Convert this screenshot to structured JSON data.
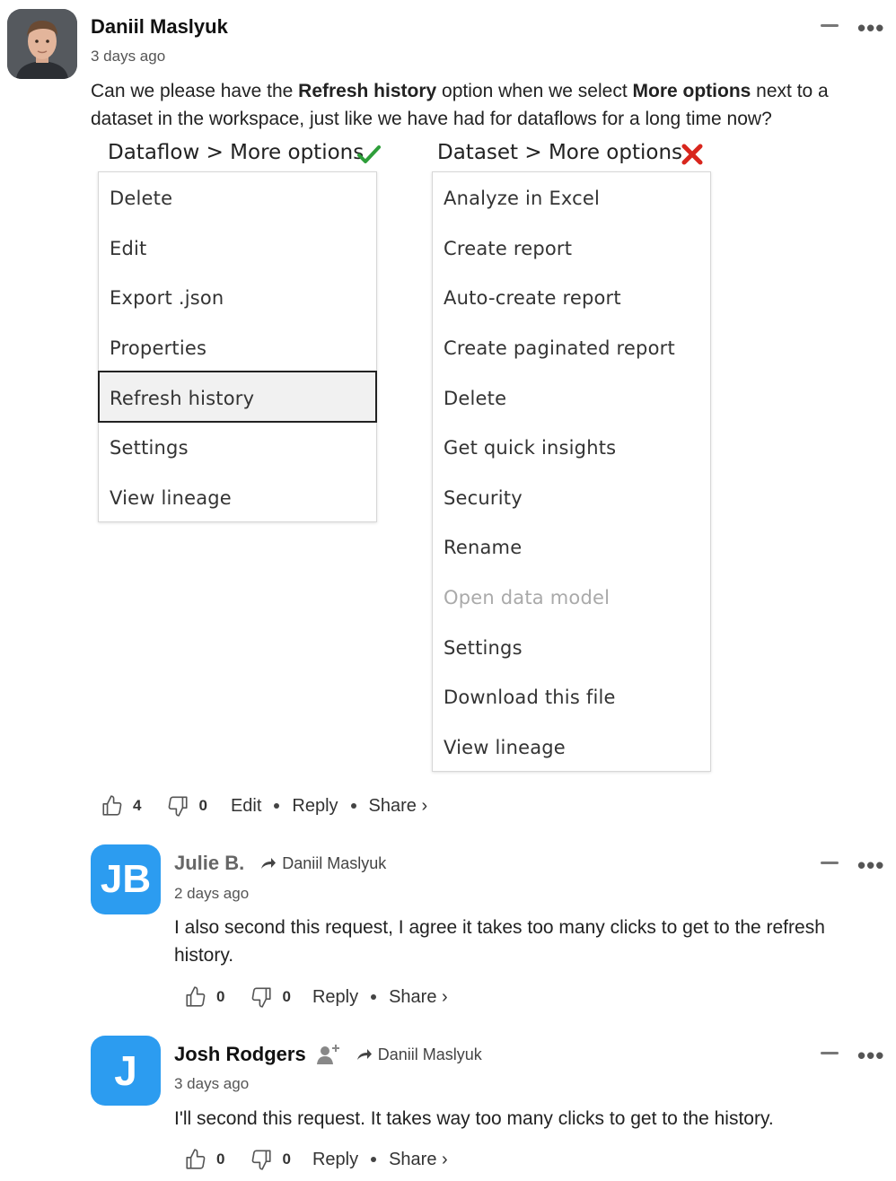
{
  "post": {
    "author": "Daniil Maslyuk",
    "time": "3 days ago",
    "body_pre": "Can we please have the ",
    "body_b1": "Refresh history",
    "body_mid": " option when we select ",
    "body_b2": "More options",
    "body_post": " next to a dataset in the workspace, just like we have had for dataflows for a long time now?",
    "likes": "4",
    "dislikes": "0",
    "edit_label": "Edit",
    "reply_label": "Reply",
    "share_label": "Share ›"
  },
  "screenshot": {
    "left_title": "Dataflow > More options",
    "right_title": "Dataset > More options",
    "left_items": [
      "Delete",
      "Edit",
      "Export .json",
      "Properties",
      "Refresh history",
      "Settings",
      "View lineage"
    ],
    "right_items": [
      "Analyze in Excel",
      "Create report",
      "Auto-create report",
      "Create paginated report",
      "Delete",
      "Get quick insights",
      "Security",
      "Rename",
      "Open data model",
      "Settings",
      "Download this file",
      "View lineage"
    ],
    "check_color": "#2e9e3a",
    "cross_color": "#d8261d"
  },
  "replies": [
    {
      "initials": "JB",
      "author": "Julie B.",
      "reply_to": "Daniil Maslyuk",
      "time": "2 days ago",
      "body": "I also second this request, I agree it takes too many clicks to get to the refresh history.",
      "likes": "0",
      "dislikes": "0",
      "reply_label": "Reply",
      "share_label": "Share ›"
    },
    {
      "initials": "J",
      "author": "Josh Rodgers",
      "reply_to": "Daniil Maslyuk",
      "time": "3 days ago",
      "body": "I'll second this request. It takes way too many clicks to get to the history.",
      "likes": "0",
      "dislikes": "0",
      "reply_label": "Reply",
      "share_label": "Share ›"
    }
  ],
  "colors": {
    "avatar_blue": "#2c9cf0"
  }
}
